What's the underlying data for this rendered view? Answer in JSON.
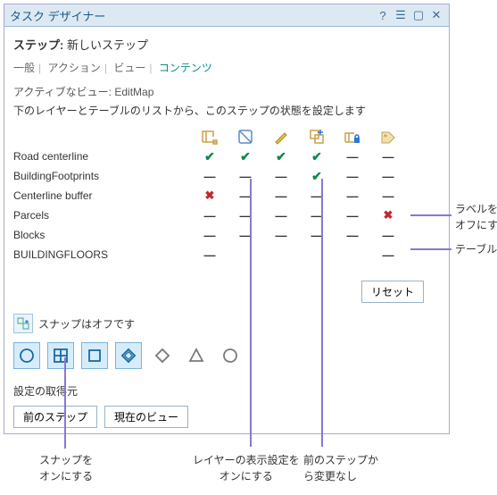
{
  "title": "タスク デザイナー",
  "step_prefix": "ステップ:",
  "step_name": "新しいステップ",
  "tabs": {
    "general": "一般",
    "action": "アクション",
    "view": "ビュー",
    "contents": "コンテンツ"
  },
  "active_view_label": "アクティブなビュー:",
  "active_view_value": "EditMap",
  "desc": "下のレイヤーとテーブルのリストから、このステップの状態を設定します",
  "columns": [
    "layer-vis",
    "select",
    "edit",
    "add",
    "lock",
    "label"
  ],
  "layers": [
    {
      "name": "Road centerline",
      "states": [
        "chk",
        "chk",
        "chk",
        "chk",
        "dash",
        "dash"
      ]
    },
    {
      "name": "BuildingFootprints",
      "states": [
        "dash",
        "dash",
        "dash",
        "chk",
        "dash",
        "dash"
      ]
    },
    {
      "name": "Centerline buffer",
      "states": [
        "cross",
        "dash",
        "dash",
        "dash",
        "dash",
        "dash"
      ]
    },
    {
      "name": "Parcels",
      "states": [
        "dash",
        "dash",
        "dash",
        "dash",
        "dash",
        "cross"
      ]
    },
    {
      "name": "Blocks",
      "states": [
        "dash",
        "dash",
        "dash",
        "dash",
        "dash",
        "dash"
      ]
    },
    {
      "name": "BUILDINGFLOORS",
      "states": [
        "dash",
        "",
        "",
        "",
        "",
        "dash"
      ]
    }
  ],
  "reset_label": "リセット",
  "snap_status": "スナップはオフです",
  "snap_shapes": [
    {
      "name": "snap-circle",
      "on": true
    },
    {
      "name": "snap-grid",
      "on": true
    },
    {
      "name": "snap-square",
      "on": true
    },
    {
      "name": "snap-diamond-sq",
      "on": true
    },
    {
      "name": "snap-diamond",
      "on": false
    },
    {
      "name": "snap-triangle",
      "on": false
    },
    {
      "name": "snap-ring",
      "on": false
    }
  ],
  "settings_from": "設定の取得元",
  "btn_prev": "前のステップ",
  "btn_curview": "現在のビュー",
  "callouts": {
    "label_off": "ラベルを\nオフにする",
    "table": "テーブル",
    "snap_on": "スナップを\nオンにする",
    "layer_vis_on": "レイヤーの表示設定を\nオンにする",
    "prev_unchanged": "前のステップか\nら変更なし"
  }
}
